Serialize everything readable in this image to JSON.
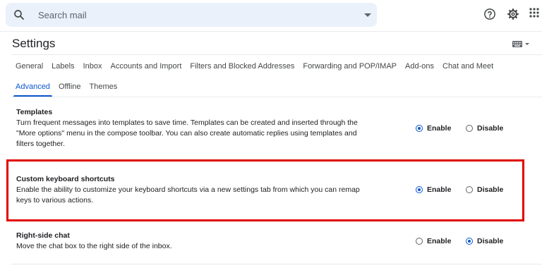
{
  "search": {
    "placeholder": "Search mail"
  },
  "header": {
    "title": "Settings"
  },
  "tabs": {
    "row1": [
      "General",
      "Labels",
      "Inbox",
      "Accounts and Import",
      "Filters and Blocked Addresses",
      "Forwarding and POP/IMAP",
      "Add-ons",
      "Chat and Meet"
    ],
    "row2": [
      "Advanced",
      "Offline",
      "Themes"
    ],
    "active": "Advanced"
  },
  "settings": [
    {
      "title": "Templates",
      "description": "Turn frequent messages into templates to save time. Templates can be created and inserted through the \"More options\" menu in the compose toolbar. You can also create automatic replies using templates and filters together.",
      "enable_label": "Enable",
      "disable_label": "Disable",
      "selected": "enable"
    },
    {
      "title": "Custom keyboard shortcuts",
      "description": "Enable the ability to customize your keyboard shortcuts via a new settings tab from which you can remap keys to various actions.",
      "enable_label": "Enable",
      "disable_label": "Disable",
      "selected": "enable"
    },
    {
      "title": "Right-side chat",
      "description": "Move the chat box to the right side of the inbox.",
      "enable_label": "Enable",
      "disable_label": "Disable",
      "selected": "disable"
    }
  ],
  "colors": {
    "accent": "#0b57d0",
    "highlight": "#e00000",
    "search_bg": "#eaf1fb"
  },
  "icons": [
    "search-icon",
    "help-icon",
    "gear-icon",
    "apps-icon",
    "keyboard-icon"
  ]
}
